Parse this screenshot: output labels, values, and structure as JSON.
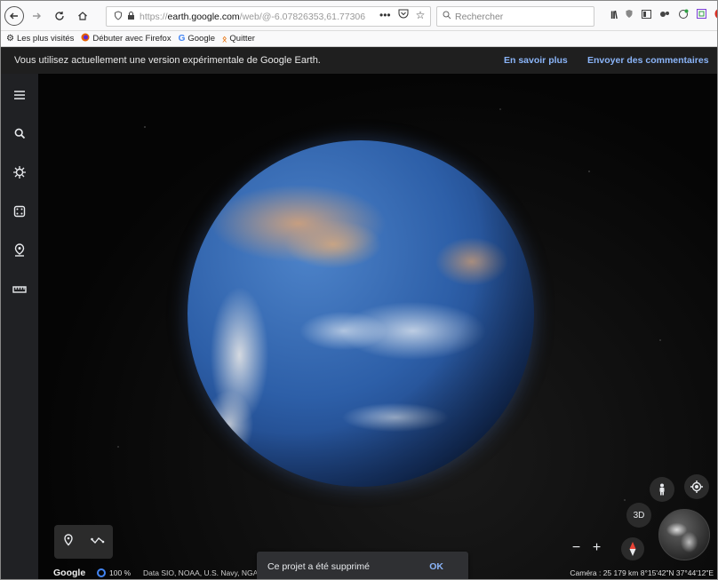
{
  "browser": {
    "url_prefix": "https://",
    "url_host": "earth.google.com",
    "url_path": "/web/@-6.07826353,61.77306",
    "more_icon": "ellipsis-icon",
    "search_placeholder": "Rechercher",
    "bookmarks": [
      {
        "label": "Les plus visités",
        "icon": "gear-icon"
      },
      {
        "label": "Débuter avec Firefox",
        "icon": "firefox-icon"
      },
      {
        "label": "Google",
        "icon": "google-g-icon"
      },
      {
        "label": "Quitter",
        "icon": "quit-icon"
      }
    ]
  },
  "notice": {
    "text": "Vous utilisez actuellement une version expérimentale de Google Earth.",
    "learn_more": "En savoir plus",
    "feedback": "Envoyer des commentaires"
  },
  "rail": {
    "items": [
      "menu-icon",
      "search-icon",
      "voyager-icon",
      "dice-icon",
      "projects-icon",
      "ruler-icon"
    ]
  },
  "status": {
    "brand": "Google",
    "load_percent": "100 %",
    "attribution": "Data SIO, NOAA, U.S. Navy, NGA, G",
    "camera": "Caméra : 25 179 km  8°15'42\"N 37°44'12\"E"
  },
  "snackbar": {
    "message": "Ce projet a été supprimé",
    "action": "OK"
  },
  "controls": {
    "view_3d": "3D",
    "zoom_out": "−",
    "zoom_in": "+"
  },
  "colors": {
    "accent": "#8ab4f8",
    "rail_bg": "#202124",
    "notice_bg": "#1f1f1f"
  }
}
